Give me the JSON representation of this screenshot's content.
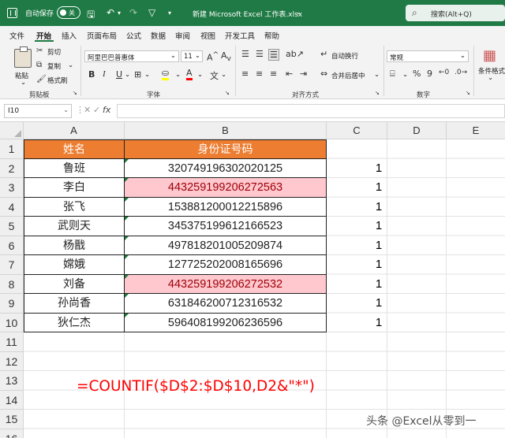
{
  "titlebar": {
    "autosave_label": "自动保存",
    "autosave_state": "关",
    "title": "新建 Microsoft Excel 工作表.xlsx",
    "search_placeholder": "搜索(Alt+Q)",
    "accent_color": "#1f7a45"
  },
  "menu": [
    "文件",
    "开始",
    "插入",
    "页面布局",
    "公式",
    "数据",
    "审阅",
    "视图",
    "开发工具",
    "帮助"
  ],
  "ribbon": {
    "clipboard": {
      "paste": "粘贴",
      "cut": "剪切",
      "copy": "复制",
      "format_painter": "格式刷",
      "group": "剪贴板"
    },
    "font": {
      "name": "阿里巴巴普惠体",
      "size": "11",
      "bold": "B",
      "italic": "I",
      "underline": "U",
      "group": "字体",
      "font_color": "#ff0000",
      "fill_color": "#ffff00"
    },
    "alignment": {
      "wrap": "自动换行",
      "merge": "合并后居中",
      "group": "对齐方式"
    },
    "number": {
      "format": "常规",
      "percent": "%",
      "comma": "9",
      "group": "数字"
    },
    "styles": {
      "conditional": "条件格式"
    }
  },
  "formula_bar": {
    "name_box": "I10",
    "fx": "fx",
    "content": ""
  },
  "columns": [
    "A",
    "B",
    "C",
    "D",
    "E"
  ],
  "rows": [
    "1",
    "2",
    "3",
    "4",
    "5",
    "6",
    "7",
    "8",
    "9",
    "10",
    "11",
    "12",
    "13",
    "14",
    "15",
    "16"
  ],
  "table": {
    "headers": [
      "姓名",
      "身份证号码"
    ],
    "header_color": "#ed7d31",
    "duplicate_fill": "#ffc7ce",
    "rows": [
      {
        "name": "鲁班",
        "id": "320749196302020125",
        "count": "1",
        "duplicate": false
      },
      {
        "name": "李白",
        "id": "443259199206272563",
        "count": "1",
        "duplicate": true
      },
      {
        "name": "张飞",
        "id": "153881200012215896",
        "count": "1",
        "duplicate": false
      },
      {
        "name": "武则天",
        "id": "345375199612166523",
        "count": "1",
        "duplicate": false
      },
      {
        "name": "杨戬",
        "id": "497818201005209874",
        "count": "1",
        "duplicate": false
      },
      {
        "name": "嫦娥",
        "id": "127725202008165696",
        "count": "1",
        "duplicate": false
      },
      {
        "name": "刘备",
        "id": "443259199206272532",
        "count": "1",
        "duplicate": true
      },
      {
        "name": "孙尚香",
        "id": "631846200712316532",
        "count": "1",
        "duplicate": false
      },
      {
        "name": "狄仁杰",
        "id": "596408199206236596",
        "count": "1",
        "duplicate": false
      }
    ]
  },
  "annotation": {
    "formula": "=COUNTIF($D$2:$D$10,D2&\"*\")",
    "color": "#ff0000"
  },
  "watermark": "头条 @Excel从零到一"
}
